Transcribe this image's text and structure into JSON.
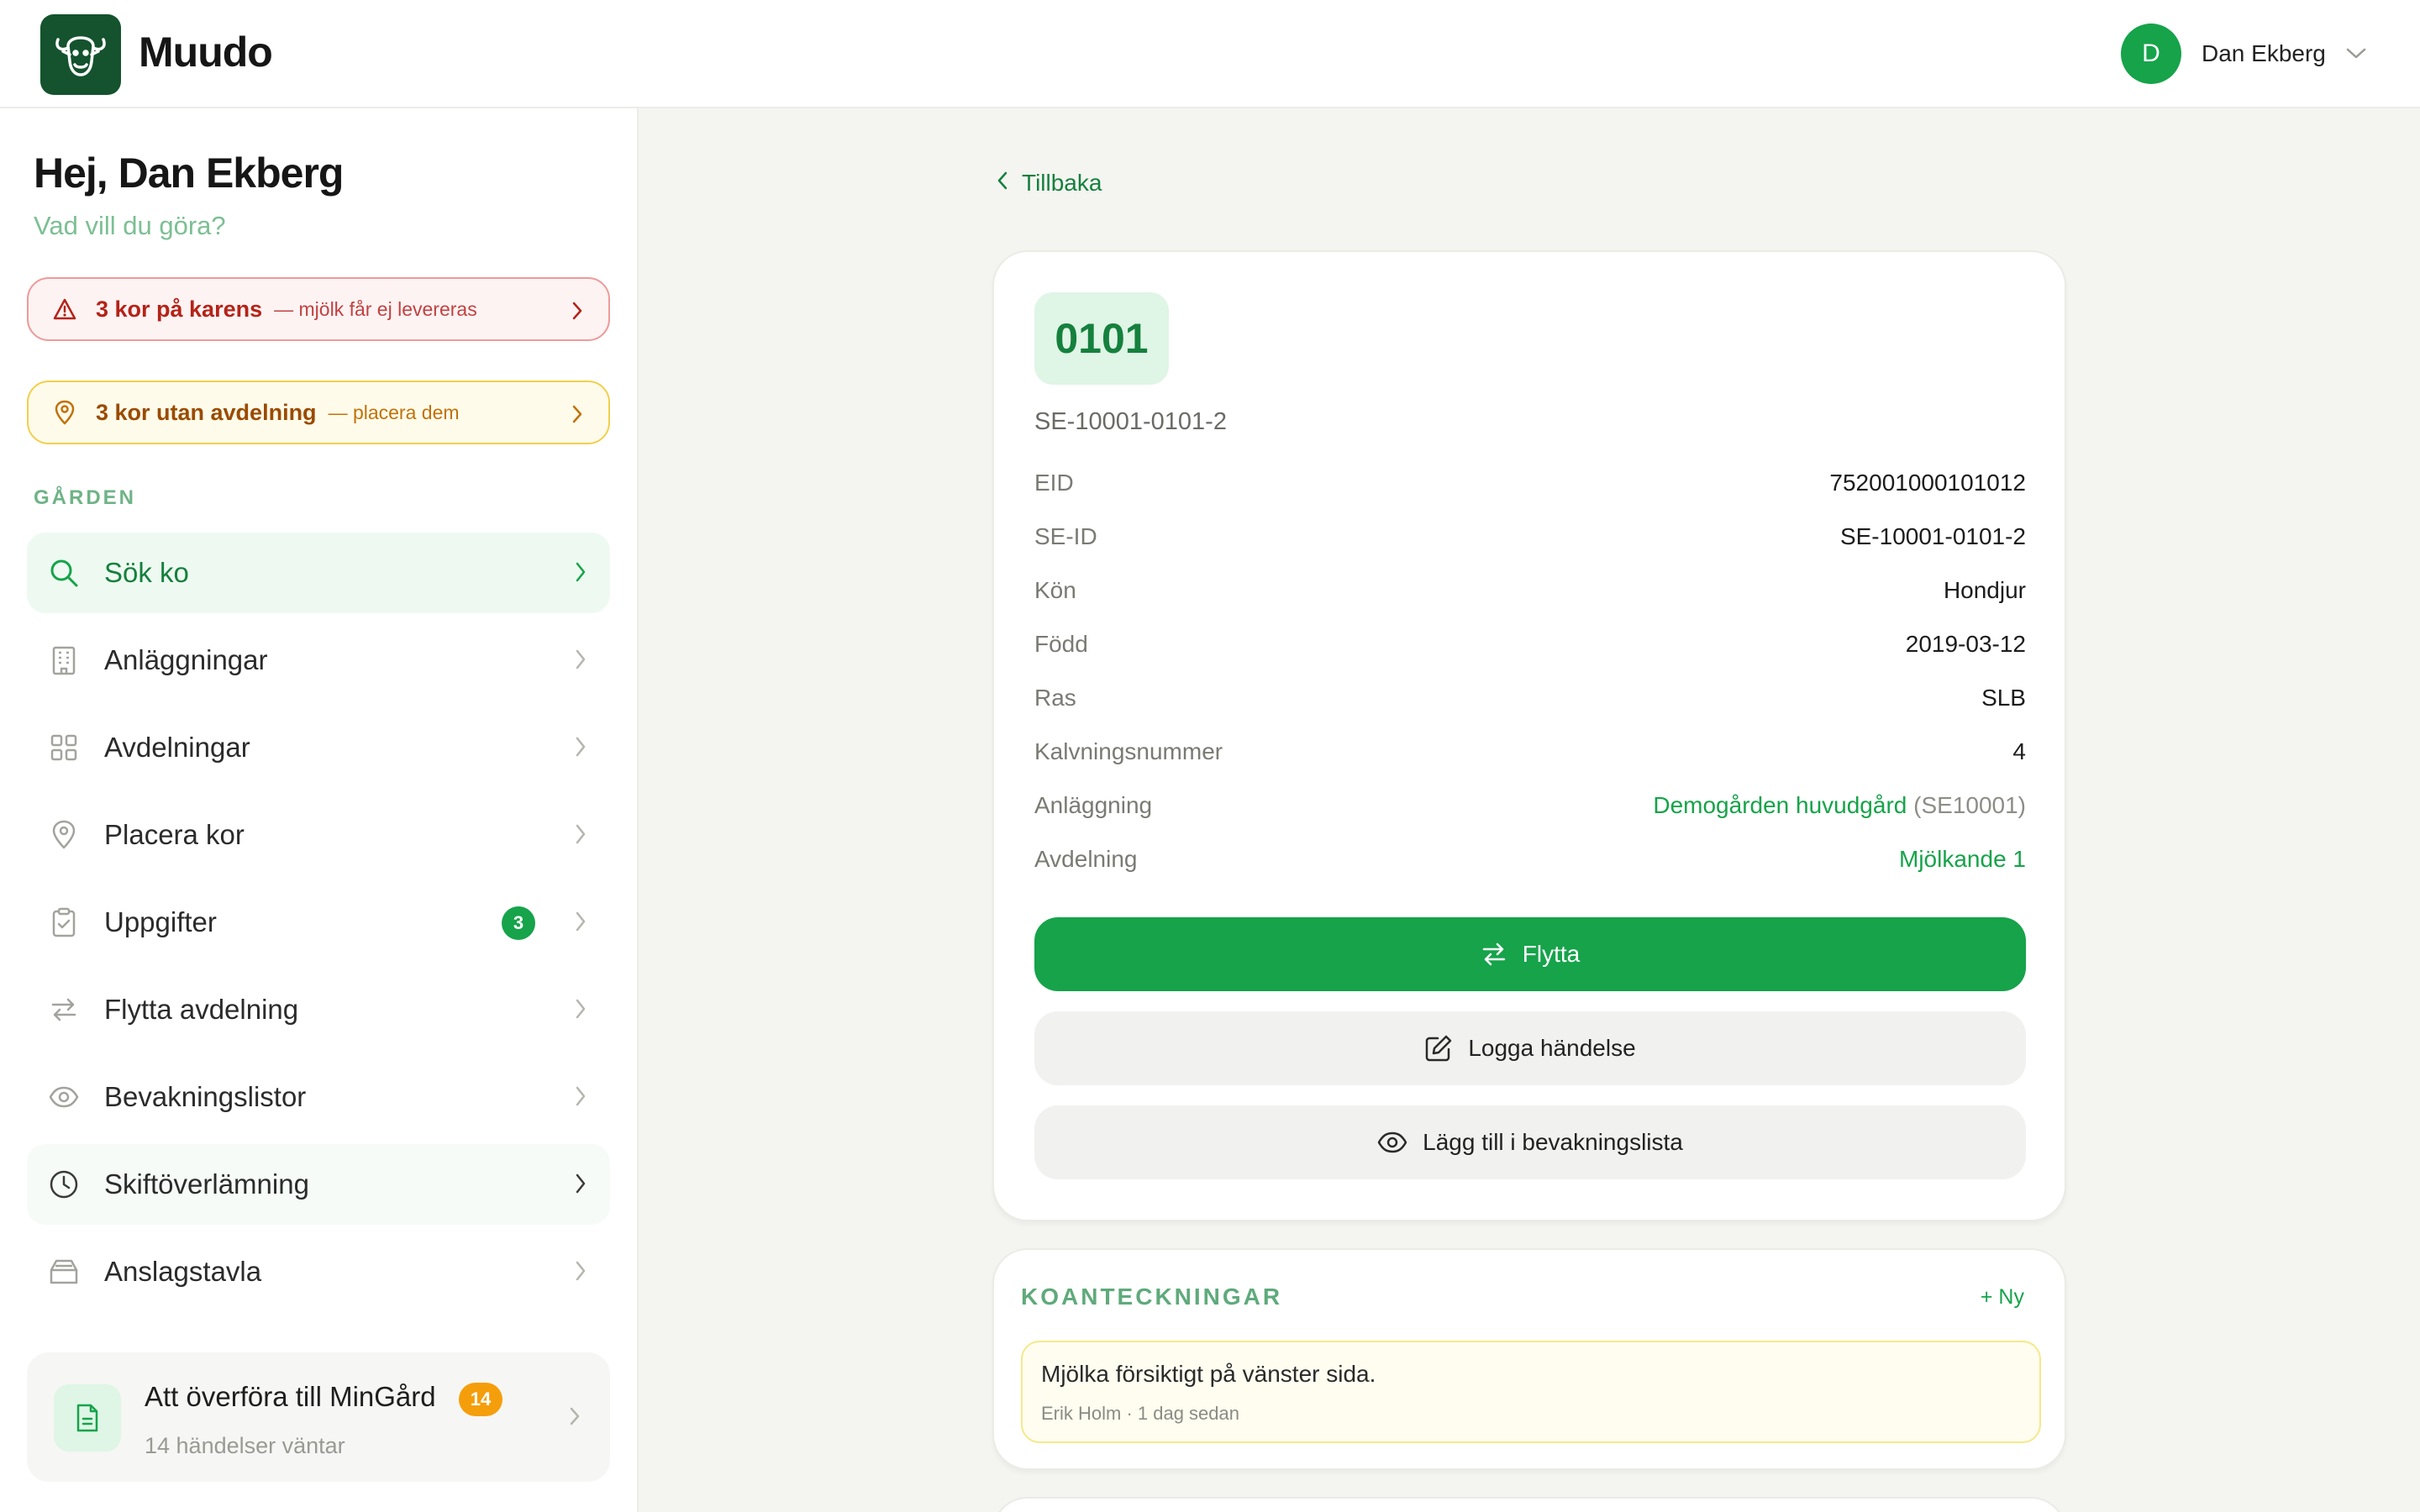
{
  "header": {
    "brand": "Muudo",
    "user": {
      "initial": "D",
      "name": "Dan Ekberg"
    }
  },
  "sidebar": {
    "greeting": "Hej, Dan Ekberg",
    "subtitle": "Vad vill du göra?",
    "alerts": [
      {
        "strong": "3 kor på karens",
        "rest": "— mjölk får ej levereras",
        "tone": "danger",
        "color": "#b42318"
      },
      {
        "strong": "3 kor utan avdelning",
        "rest": "— placera dem",
        "tone": "warning",
        "color": "#9a4b00"
      }
    ],
    "section_label": "GÅRDEN",
    "items": [
      {
        "label": "Sök ko",
        "icon": "search-icon",
        "active": true
      },
      {
        "label": "Anläggningar",
        "icon": "building-icon"
      },
      {
        "label": "Avdelningar",
        "icon": "grid-icon"
      },
      {
        "label": "Placera kor",
        "icon": "map-pin-icon"
      },
      {
        "label": "Uppgifter",
        "icon": "clipboard-icon",
        "badge": "3"
      },
      {
        "label": "Flytta avdelning",
        "icon": "swap-arrows-icon"
      },
      {
        "label": "Bevakningslistor",
        "icon": "eye-icon"
      },
      {
        "label": "Skiftöverlämning",
        "icon": "clock-icon"
      },
      {
        "label": "Anslagstavla",
        "icon": "inbox-tray-icon"
      }
    ],
    "transfer": {
      "title": "Att överföra till MinGård",
      "badge": "14",
      "subtitle": "14 händelser väntar",
      "icon": "document-icon"
    }
  },
  "main": {
    "back_label": "Tillbaka",
    "cow": {
      "number": "0101",
      "full_id": "SE-10001-0101-2",
      "details": [
        {
          "key": "EID",
          "value": "752001000101012"
        },
        {
          "key": "SE-ID",
          "value": "SE-10001-0101-2"
        },
        {
          "key": "Kön",
          "value": "Hondjur"
        },
        {
          "key": "Född",
          "value": "2019-03-12"
        },
        {
          "key": "Ras",
          "value": "SLB"
        },
        {
          "key": "Kalvningsnummer",
          "value": "4"
        },
        {
          "key": "Anläggning",
          "value": "Demogården huvudgård",
          "suffix": "(SE10001)",
          "link": true
        },
        {
          "key": "Avdelning",
          "value": "Mjölkande 1",
          "link": true
        }
      ]
    },
    "actions": {
      "move": "Flytta",
      "log_event": "Logga händelse",
      "add_watchlist": "Lägg till i bevakningslista"
    },
    "notes": {
      "title": "KOANTECKNINGAR",
      "new_label": "+ Ny",
      "items": [
        {
          "text": "Mjölka försiktigt på vänster sida.",
          "meta": "Erik Holm · 1 dag sedan"
        }
      ]
    }
  },
  "colors": {
    "accent": "#16a34a",
    "accent_dark": "#14532d",
    "accent_light": "#dff5e6",
    "danger": "#b42318",
    "warning": "#9a4b00"
  }
}
